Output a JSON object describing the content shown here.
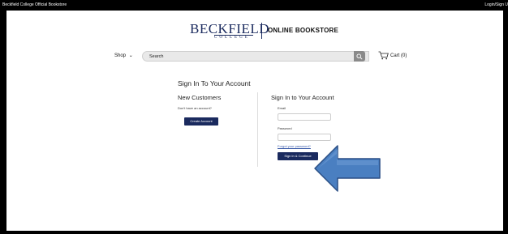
{
  "topbar": {
    "left_text": "Beckfield College Official Bookstore",
    "right_text": "Login/Sign U"
  },
  "header": {
    "logo_main": "BECKFIELD",
    "logo_sub": "COLLEGE",
    "store_name": "ONLINE BOOKSTORE"
  },
  "nav": {
    "shop_label": "Shop",
    "search_placeholder": "Search",
    "cart_label": "Cart (0)"
  },
  "main": {
    "heading": "Sign In To Your Account",
    "new_customers": {
      "title": "New Customers",
      "prompt": "Don't have an account?",
      "button": "Create Account"
    },
    "sign_in": {
      "title": "Sign In to Your Account",
      "email_label": "Email",
      "email_value": "",
      "password_label": "Password",
      "password_value": "",
      "forgot_link": "Forgot your password?",
      "submit_button": "Sign In & Continue"
    }
  },
  "colors": {
    "brand_navy": "#1a2a5e",
    "link_blue": "#3b5ba9",
    "annotation_arrow": "#4a7fc1"
  },
  "icons": [
    "chevron-down-icon",
    "search-icon",
    "cart-icon",
    "arrow-annotation-icon"
  ]
}
